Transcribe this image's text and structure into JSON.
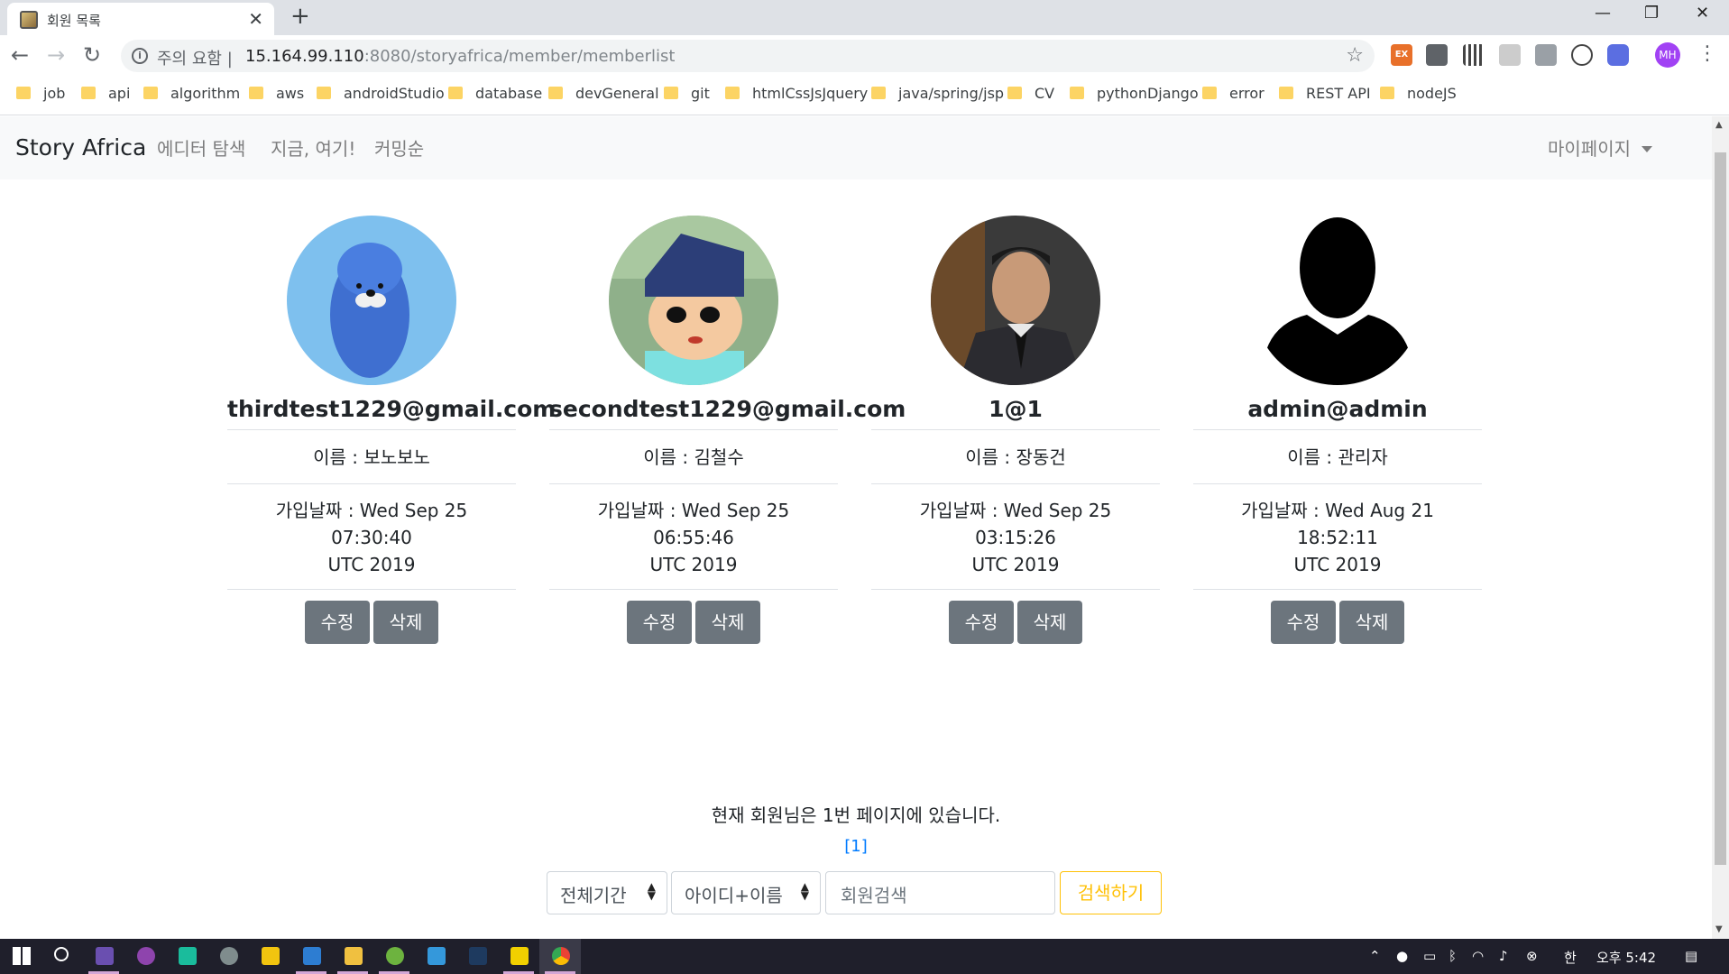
{
  "browser": {
    "tab_title": "회원 목록",
    "new_tab": "+",
    "security_warning": "주의 요함",
    "url_host": "15.164.99.110",
    "url_path": ":8080/storyafrica/member/memberlist",
    "profile_initials": "MH",
    "extension_ex_label": "EX",
    "bookmarks": [
      "job",
      "api",
      "algorithm",
      "aws",
      "androidStudio",
      "database",
      "devGeneral",
      "git",
      "htmlCssJsJquery",
      "java/spring/jsp",
      "CV",
      "pythonDjango",
      "error",
      "REST API",
      "nodeJS"
    ]
  },
  "navbar": {
    "brand": "Story Africa",
    "links": [
      "에디터 탐색",
      "지금, 여기!",
      "커밍순"
    ],
    "mypage": "마이페이지"
  },
  "members": [
    {
      "email": "thirdtest1229@gmail.com",
      "name": "이름 : 보노보노",
      "date_line1": "가입날짜 : Wed Sep 25 07:30:40",
      "date_line2": "UTC 2019",
      "photo": "bonobono-avatar"
    },
    {
      "email": "secondtest1229@gmail.com",
      "name": "이름 : 김철수",
      "date_line1": "가입날짜 : Wed Sep 25 06:55:46",
      "date_line2": "UTC 2019",
      "photo": "cartoon-boy-avatar"
    },
    {
      "email": "1@1",
      "name": "이름 : 장동건",
      "date_line1": "가입날짜 : Wed Sep 25 03:15:26",
      "date_line2": "UTC 2019",
      "photo": "man-in-suit-photo"
    },
    {
      "email": "admin@admin",
      "name": "이름 : 관리자",
      "date_line1": "가입날짜 : Wed Aug 21 18:52:11",
      "date_line2": "UTC 2019",
      "photo": "default-user-silhouette"
    }
  ],
  "buttons": {
    "edit": "수정",
    "delete": "삭제"
  },
  "pagination": {
    "status": "현재 회원님은 1번 페이지에 있습니다.",
    "link": "[1]"
  },
  "search": {
    "period_select": "전체기간",
    "field_select": "아이디+이름",
    "placeholder": "회원검색",
    "button": "검색하기"
  },
  "taskbar": {
    "clock": "오후 5:42",
    "ime": "한"
  },
  "colors": {
    "secondary_button": "#6c757d",
    "warning_outline": "#ffc107",
    "link_blue": "#007bff",
    "navbar_bg": "#f8f9fa"
  }
}
